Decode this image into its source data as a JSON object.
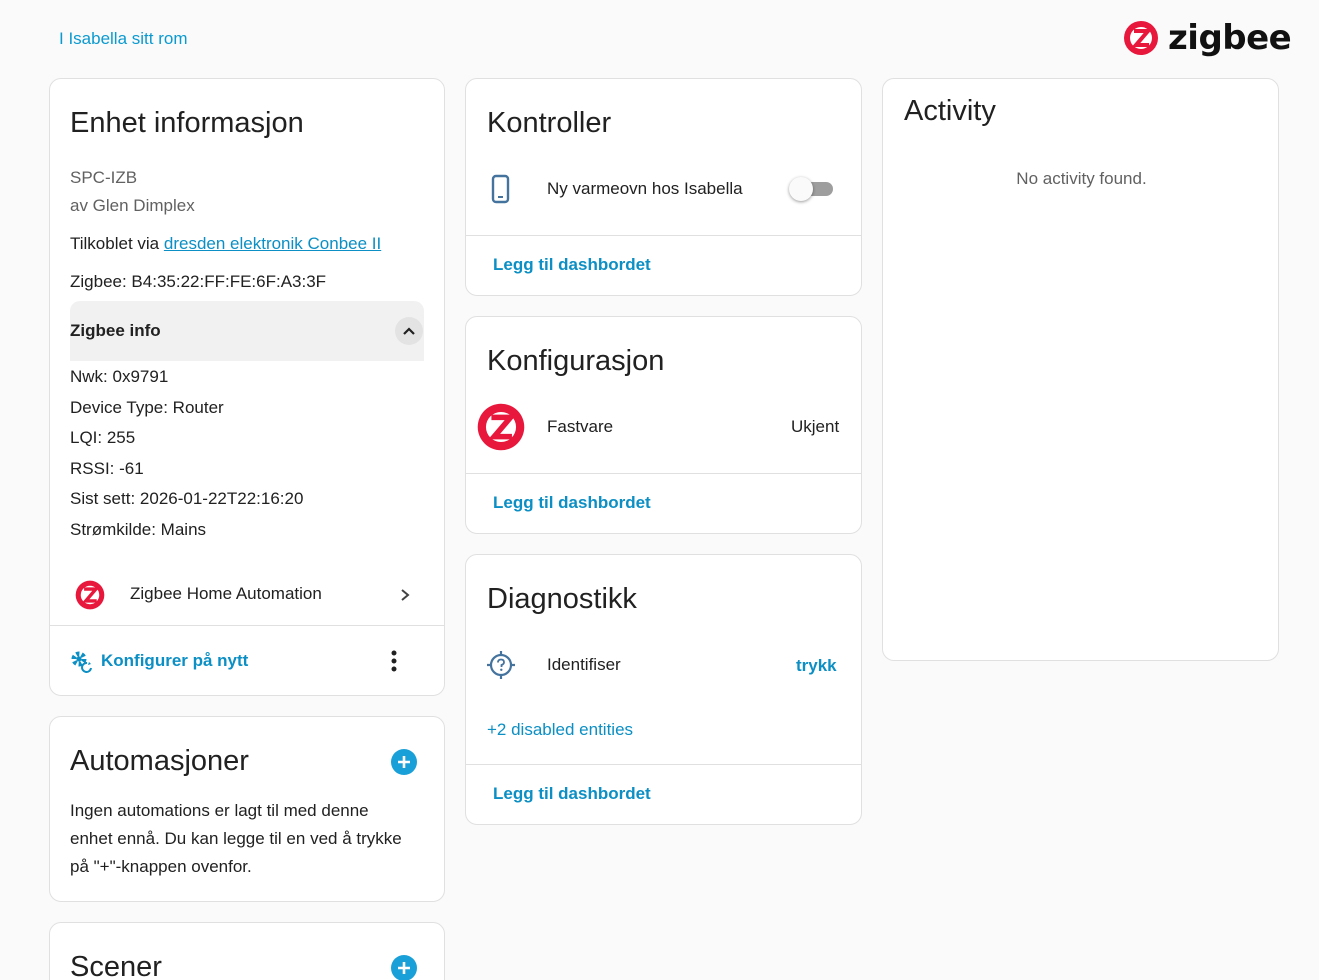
{
  "header": {
    "area_link": "I Isabella sitt rom",
    "brand": "zigbee"
  },
  "device_info": {
    "title": "Enhet informasjon",
    "model": "SPC-IZB",
    "manufacturer": "av Glen Dimplex",
    "connected_prefix": "Tilkoblet via",
    "connected_link": "dresden elektronik Conbee II",
    "zigbee_id": "Zigbee: B4:35:22:FF:FE:6F:A3:3F",
    "zigbee_info": {
      "title": "Zigbee info",
      "expanded": true,
      "lines": [
        "Nwk: 0x9791",
        "Device Type: Router",
        "LQI: 255",
        "RSSI: -61",
        "Sist sett: 2026-01-22T22:16:20",
        "Strømkilde: Mains"
      ]
    },
    "integration": "Zigbee Home Automation",
    "reconfigure_label": "Konfigurer på nytt"
  },
  "automations": {
    "title": "Automasjoner",
    "empty_text_lines": [
      "Ingen automations er lagt til med denne",
      "enhet ennå. Du kan legge til en ved å trykke",
      "på \"+\"-knappen ovenfor."
    ]
  },
  "scenes": {
    "title": "Scener"
  },
  "controls": {
    "title": "Kontroller",
    "entity_name": "Ny varmeovn hos Isabella",
    "entity_state": "off",
    "add_to_dashboard": "Legg til dashbordet"
  },
  "configuration": {
    "title": "Konfigurasjon",
    "entity_name": "Fastvare",
    "entity_value": "Ukjent",
    "add_to_dashboard": "Legg til dashbordet"
  },
  "diagnostics": {
    "title": "Diagnostikk",
    "entity_name": "Identifiser",
    "entity_action": "trykk",
    "disabled_entities": "+2 disabled entities",
    "add_to_dashboard": "Legg til dashbordet"
  },
  "activity": {
    "title": "Activity",
    "empty_text": "No activity found."
  },
  "colors": {
    "accent": "#0b8fc4",
    "zigbee_red": "#e8173c",
    "plus_button": "#1aa0d8"
  }
}
